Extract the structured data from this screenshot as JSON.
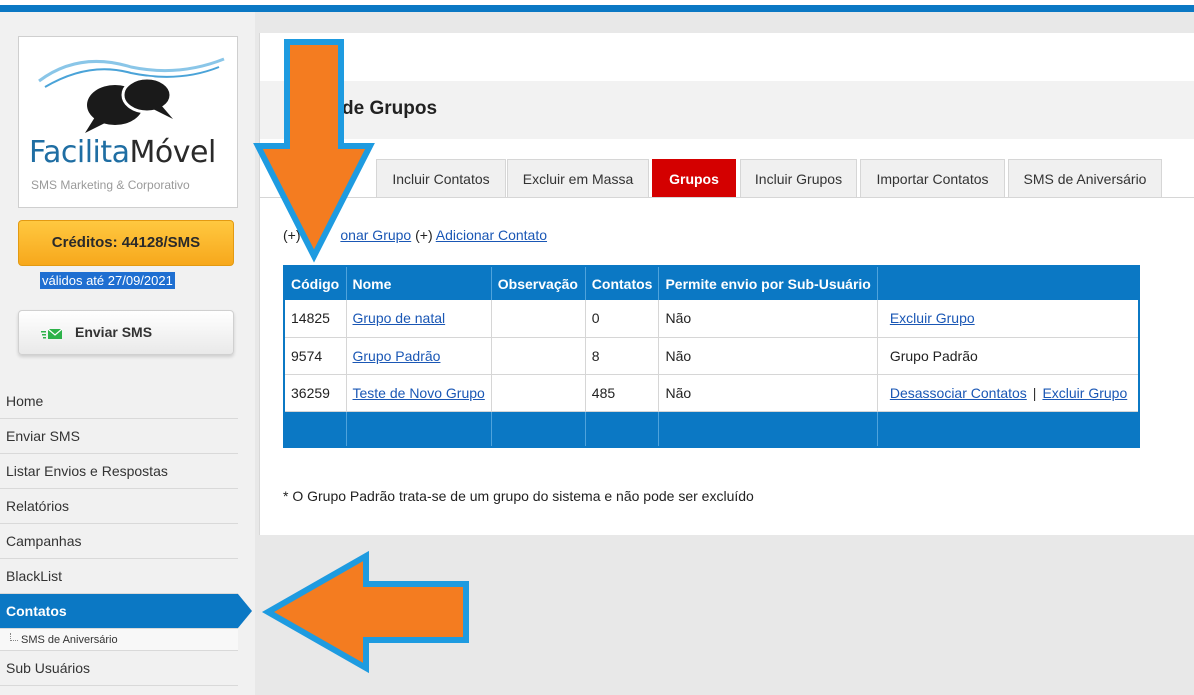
{
  "brand": {
    "name_part1": "Facilita",
    "name_part2": "Móvel",
    "tagline": "SMS Marketing & Corporativo"
  },
  "sidebar": {
    "credits_label": "Créditos: 44128/SMS",
    "validity": "válidos até 27/09/2021",
    "send_sms_label": "Enviar SMS",
    "menu": [
      {
        "label": "Home"
      },
      {
        "label": "Enviar SMS"
      },
      {
        "label": "Listar Envios e Respostas"
      },
      {
        "label": "Relatórios"
      },
      {
        "label": "Campanhas"
      },
      {
        "label": "BlackList"
      },
      {
        "label": "Contatos",
        "active": true
      },
      {
        "label": "Sub Usuários"
      }
    ],
    "submenu_label": "SMS de Aniversário"
  },
  "main": {
    "title": "de Grupos",
    "tabs": [
      {
        "label": "Incluir Contatos"
      },
      {
        "label": "Excluir em Massa"
      },
      {
        "label": "Grupos",
        "active": true
      },
      {
        "label": "Incluir Grupos"
      },
      {
        "label": "Importar Contatos"
      },
      {
        "label": "SMS de Aniversário"
      }
    ],
    "actions": {
      "prefix1": "(+)",
      "add_group": "onar Grupo",
      "prefix2": "(+)",
      "add_contact": "Adicionar Contato"
    },
    "table": {
      "headers": [
        "Código",
        "Nome",
        "Observação",
        "Contatos",
        "Permite envio por Sub-Usuário",
        ""
      ],
      "rows": [
        {
          "code": "14825",
          "name": "Grupo de natal",
          "obs": "",
          "contacts": "0",
          "allow": "Não",
          "action1": "Excluir Grupo",
          "action2": ""
        },
        {
          "code": "9574",
          "name": "Grupo Padrão",
          "obs": "",
          "contacts": "8",
          "allow": "Não",
          "action_text": "Grupo Padrão"
        },
        {
          "code": "36259",
          "name": "Teste de Novo Grupo",
          "obs": "",
          "contacts": "485",
          "allow": "Não",
          "action1": "Desassociar Contatos",
          "separator": "|",
          "action2": "Excluir Grupo"
        }
      ]
    },
    "note": "* O Grupo Padrão trata-se de um grupo do sistema e não pode ser excluído"
  },
  "colors": {
    "primary_blue": "#0b78c4",
    "active_tab_red": "#d40000",
    "credits_orange": "#f7a81c",
    "arrow_orange": "#f47c20",
    "arrow_outline": "#1e9be0",
    "link_blue": "#1a57b5"
  },
  "icons": {
    "logo": "speech-bubbles-icon",
    "send": "envelope-icon"
  }
}
